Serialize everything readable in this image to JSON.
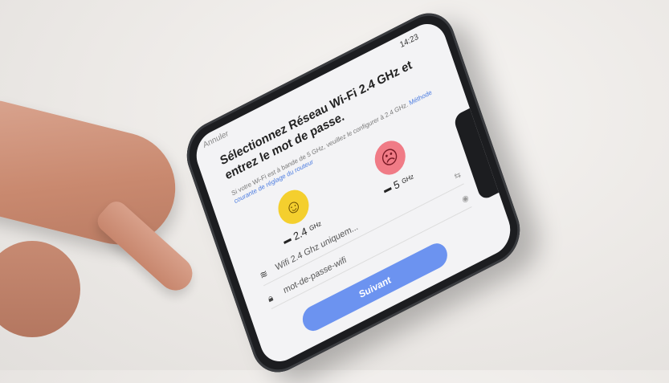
{
  "screen": {
    "status_time": "14:23",
    "cancel_label": "Annuler",
    "title": "Sélectionnez Réseau Wi-Fi 2.4 GHz et entrez le mot de passe.",
    "subtitle_text": "Si votre Wi-Fi est à bande de 5 GHz, veuillez le configurer à 2.4 GHz.",
    "subtitle_link": "Méthode courante de réglage du routeur",
    "band_24": {
      "label": "2.4",
      "unit": "GHz",
      "mood": "happy"
    },
    "band_5": {
      "label": "5",
      "unit": "GHz",
      "mood": "sad"
    },
    "ssid_field": {
      "value": "Wifi 2.4 Ghz uniquem...",
      "aux": "⇆"
    },
    "password_field": {
      "value": "mot-de-passe-wifi",
      "aux": "◉"
    },
    "next_button": "Suivant"
  },
  "colors": {
    "accent": "#6c93f0",
    "happy_face": "#f4cf2e",
    "sad_face": "#f07b86"
  }
}
